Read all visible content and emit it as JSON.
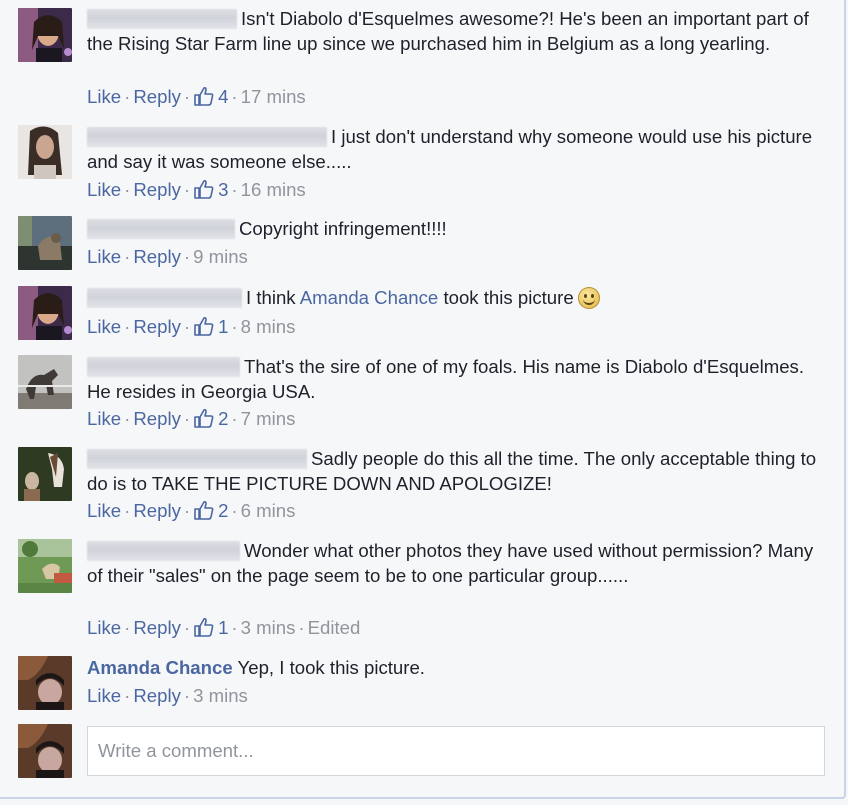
{
  "action_labels": {
    "like": "Like",
    "reply": "Reply",
    "edited": "Edited"
  },
  "comments": [
    {
      "text": "Isn't Diabolo d'Esquelmes awesome?! He's been an important part of the Rising Star Farm line up since we purchased him in Belgium as a long yearling.",
      "likes": "4",
      "time": "17 mins",
      "avatar_colors": [
        "#3b2a4a",
        "#8d5a82",
        "#d9a98a"
      ]
    },
    {
      "text": "I just don't understand why someone would use his picture and say it was someone else.....",
      "likes": "3",
      "time": "16 mins",
      "avatar_colors": [
        "#e8e5e2",
        "#3a2d26",
        "#caa58f"
      ]
    },
    {
      "text": "Copyright infringement!!!!",
      "likes": null,
      "time": "9 mins",
      "avatar_colors": [
        "#5d6f7c",
        "#8a7a66",
        "#2e3430"
      ]
    },
    {
      "text_before": "I think",
      "mention": "Amanda Chance",
      "text_after": "took this picture",
      "likes": "1",
      "time": "8 mins",
      "emoji": "smile-emoji-icon",
      "avatar_colors": [
        "#3b2a4a",
        "#8d5a82",
        "#d9a98a"
      ]
    },
    {
      "text": "That's the sire of one of my foals. His name is Diabolo d'Esquelmes. He resides in Georgia USA.",
      "likes": "2",
      "time": "7 mins",
      "avatar_colors": [
        "#c2c3c1",
        "#3f3a36",
        "#7f7a73"
      ]
    },
    {
      "text": "Sadly people do this all the time. The only acceptable thing to do is to TAKE THE PICTURE DOWN AND APOLOGIZE!",
      "likes": "2",
      "time": "6 mins",
      "avatar_colors": [
        "#2f3a22",
        "#c9b7a1",
        "#6a4a36"
      ]
    },
    {
      "text": "Wonder what other photos they have used without permission? Many of their \"sales\" on the page seem to be to one particular group......",
      "likes": "1",
      "time": "3 mins",
      "edited": true,
      "avatar_colors": [
        "#6f9a55",
        "#d7c7a5",
        "#c25a42"
      ]
    },
    {
      "name": "Amanda Chance",
      "text": "Yep, I took this picture.",
      "likes": null,
      "time": "3 mins",
      "avatar_colors": [
        "#5a3b2a",
        "#c8a7a0",
        "#1c1716"
      ]
    }
  ],
  "composer": {
    "placeholder": "Write a comment..."
  },
  "colors": {
    "link": "#4b67a1",
    "meta": "#90949c",
    "text": "#1d2129",
    "background": "#f6f7f9"
  }
}
